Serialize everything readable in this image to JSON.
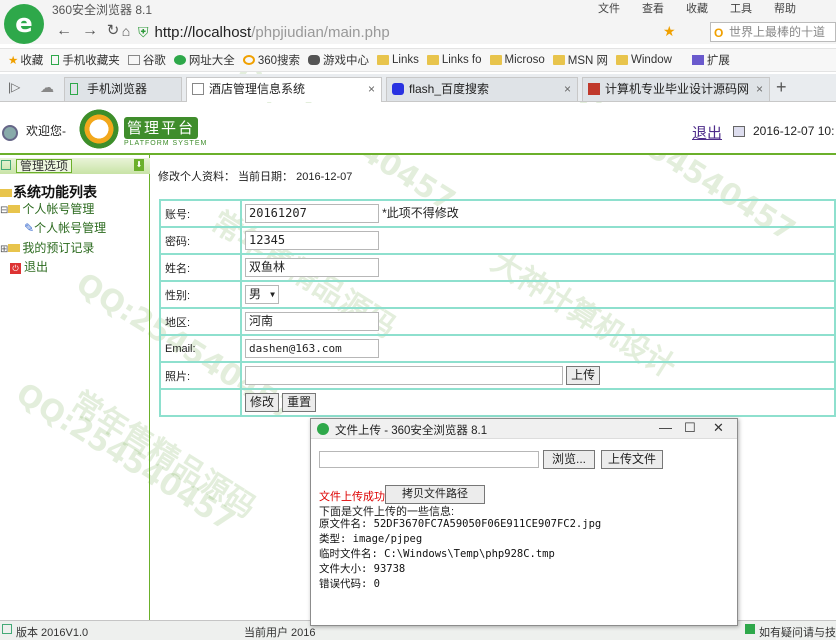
{
  "browser": {
    "window_title": "360安全浏览器 8.1",
    "menus": [
      "文件",
      "查看",
      "收藏",
      "工具",
      "帮助"
    ],
    "url_host": "http://localhost",
    "url_path": "/phpjiudian/main.php",
    "search_placeholder": "世界上最棒的十道",
    "favorites": [
      "收藏",
      "手机收藏夹",
      "谷歌",
      "网址大全",
      "360搜索",
      "游戏中心",
      "Links",
      "Links fo",
      "Microso",
      "MSN 网",
      "Window"
    ],
    "extensions_label": "扩展",
    "tabs": [
      {
        "label": "手机浏览器",
        "active": false
      },
      {
        "label": "酒店管理信息系统",
        "active": true
      },
      {
        "label": "flash_百度搜索",
        "active": false
      },
      {
        "label": "计算机专业毕业设计源码网",
        "active": false
      }
    ]
  },
  "header": {
    "welcome": "欢迎您-",
    "platform_title": "管理平台",
    "platform_subtitle": "PLATFORM SYSTEM",
    "logout": "退出",
    "date": "2016-12-07 10:"
  },
  "sidebar": {
    "panel_title": "管理选项",
    "section_title": "系统功能列表",
    "items": [
      {
        "label": "个人帐号管理",
        "level": 0
      },
      {
        "label": "个人帐号管理",
        "level": 1
      },
      {
        "label": "我的预订记录",
        "level": 0
      },
      {
        "label": "退出",
        "level": 0
      }
    ]
  },
  "main": {
    "heading": "修改个人资料：  当前日期：  2016-12-07",
    "form": {
      "account_label": "账号:",
      "account_value": "20161207",
      "account_note": "*此项不得修改",
      "password_label": "密码:",
      "password_value": "12345",
      "name_label": "姓名:",
      "name_value": "双鱼林",
      "gender_label": "性别:",
      "gender_value": "男",
      "region_label": "地区:",
      "region_value": "河南",
      "email_label": "Email:",
      "email_value": "dashen@163.com",
      "photo_label": "照片:",
      "upload_button": "上传",
      "modify_button": "修改",
      "reset_button": "重置"
    }
  },
  "statusbar": {
    "version": "版本 2016V1.0",
    "current_user": "当前用户 2016",
    "help": "如有疑问请与技"
  },
  "popup": {
    "title": "文件上传 - 360安全浏览器 8.1",
    "browse_button": "浏览...",
    "upload_button": "上传文件",
    "success_text": "文件上传成功!",
    "copy_button": "拷贝文件路径",
    "info_header": "下面是文件上传的一些信息:",
    "lines": [
      "原文件名: 52DF3670FC7A59050F06E911CE907FC2.jpg",
      "类型: image/pjpeg",
      "临时文件名: C:\\Windows\\Temp\\php928C.tmp",
      "文件大小: 93738",
      "错误代码: 0"
    ]
  },
  "watermarks": [
    "QQ:254540457",
    "大神计算机设计",
    "常年售精品源码"
  ]
}
